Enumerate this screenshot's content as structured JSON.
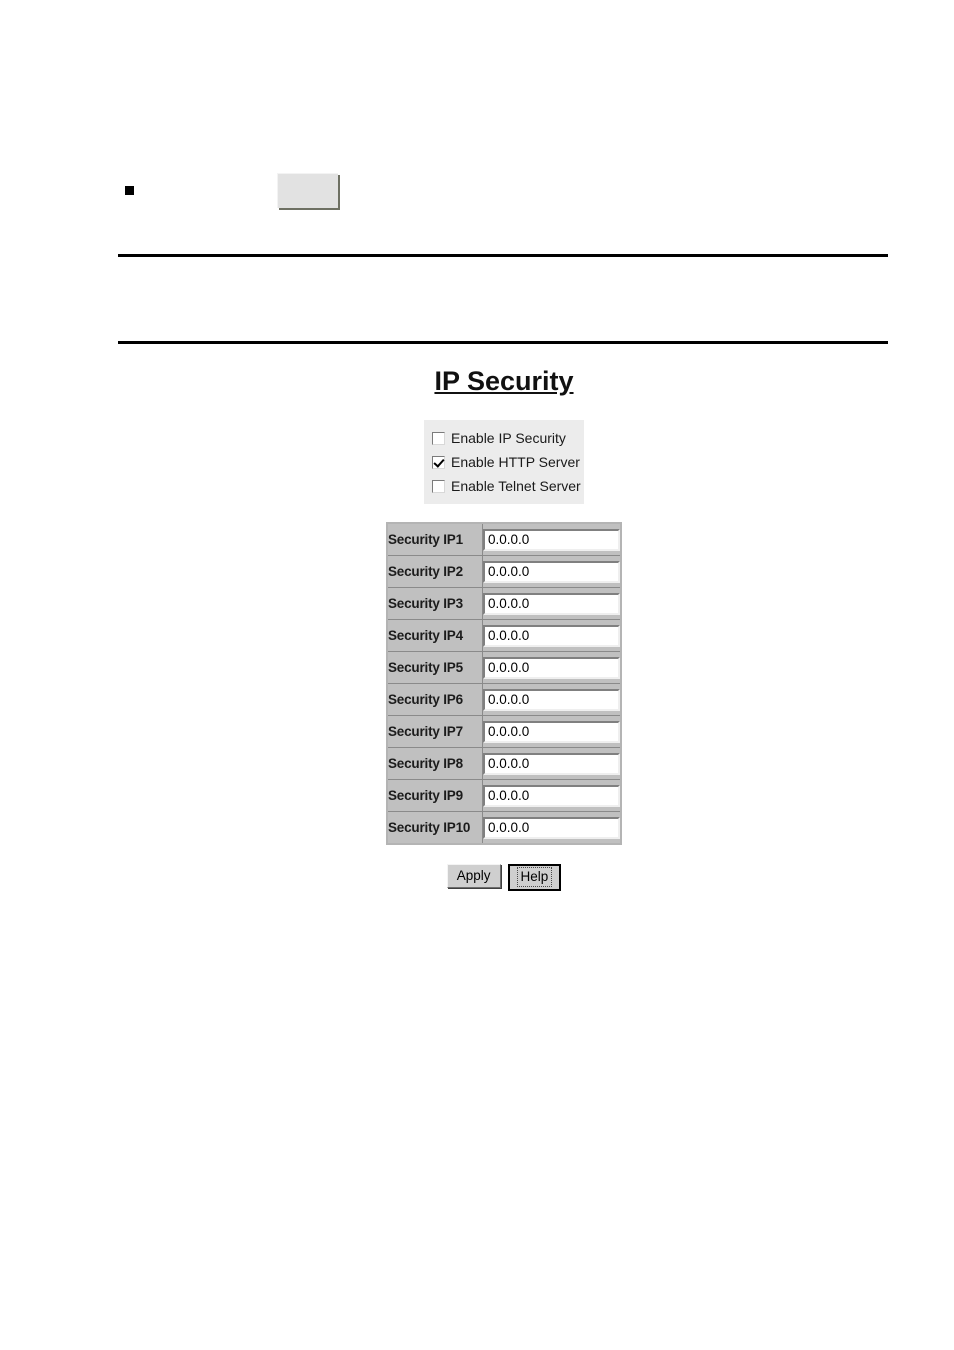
{
  "page": {
    "background": "#ffffff",
    "bullet_row": {
      "marker": "square-bullet",
      "text": "",
      "inline_box_label": ""
    },
    "rule_band_text": ""
  },
  "panel": {
    "title": "IP Security",
    "checkboxes": [
      {
        "label": "Enable IP Security",
        "checked": false
      },
      {
        "label": "Enable HTTP Server",
        "checked": true
      },
      {
        "label": "Enable Telnet Server",
        "checked": false
      }
    ],
    "table": {
      "rows": [
        {
          "label": "Security IP1",
          "value": "0.0.0.0"
        },
        {
          "label": "Security IP2",
          "value": "0.0.0.0"
        },
        {
          "label": "Security IP3",
          "value": "0.0.0.0"
        },
        {
          "label": "Security IP4",
          "value": "0.0.0.0"
        },
        {
          "label": "Security IP5",
          "value": "0.0.0.0"
        },
        {
          "label": "Security IP6",
          "value": "0.0.0.0"
        },
        {
          "label": "Security IP7",
          "value": "0.0.0.0"
        },
        {
          "label": "Security IP8",
          "value": "0.0.0.0"
        },
        {
          "label": "Security IP9",
          "value": "0.0.0.0"
        },
        {
          "label": "Security IP10",
          "value": "0.0.0.0"
        }
      ]
    },
    "buttons": {
      "apply_label": "Apply",
      "help_label": "Help"
    }
  },
  "colors": {
    "table_header_bg": "#c0c0c0",
    "checkgroup_bg": "#ececec",
    "button_bg": "#cfcfcf",
    "rule": "#000000",
    "text": "#000000"
  }
}
